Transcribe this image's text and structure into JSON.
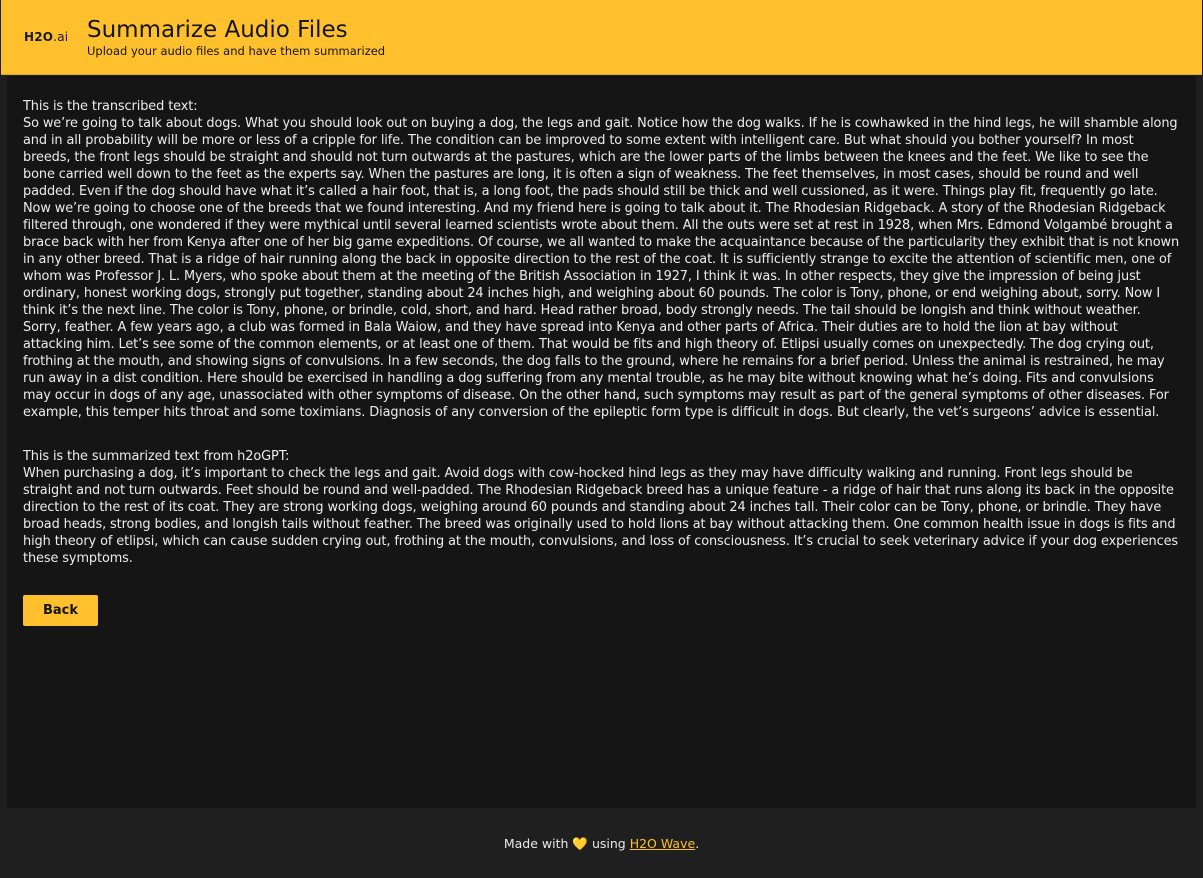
{
  "header": {
    "logo_text": "H2O",
    "logo_suffix": ".ai",
    "title": "Summarize Audio Files",
    "subtitle": "Upload your audio files and have them summarized"
  },
  "transcript": {
    "label": "This is the transcribed text:",
    "text": "So we’re going to talk about dogs. What you should look out on buying a dog, the legs and gait. Notice how the dog walks. If he is cowhawked in the hind legs, he will shamble along and in all probability will be more or less of a cripple for life. The condition can be improved to some extent with intelligent care. But what should you bother yourself? In most breeds, the front legs should be straight and should not turn outwards at the pastures, which are the lower parts of the limbs between the knees and the feet. We like to see the bone carried well down to the feet as the experts say. When the pastures are long, it is often a sign of weakness. The feet themselves, in most cases, should be round and well padded. Even if the dog should have what it’s called a hair foot, that is, a long foot, the pads should still be thick and well cussioned, as it were. Things play fit, frequently go late. Now we’re going to choose one of the breeds that we found interesting. And my friend here is going to talk about it. The Rhodesian Ridgeback. A story of the Rhodesian Ridgeback filtered through, one wondered if they were mythical until several learned scientists wrote about them. All the outs were set at rest in 1928, when Mrs. Edmond Volgambé brought a brace back with her from Kenya after one of her big game expeditions. Of course, we all wanted to make the acquaintance because of the particularity they exhibit that is not known in any other breed. That is a ridge of hair running along the back in opposite direction to the rest of the coat. It is sufficiently strange to excite the attention of scientific men, one of whom was Professor J. L. Myers, who spoke about them at the meeting of the British Association in 1927, I think it was. In other respects, they give the impression of being just ordinary, honest working dogs, strongly put together, standing about 24 inches high, and weighing about 60 pounds. The color is Tony, phone, or end weighing about, sorry. Now I think it’s the next line. The color is Tony, phone, or brindle, cold, short, and hard. Head rather broad, body strongly needs. The tail should be longish and think without weather. Sorry, feather. A few years ago, a club was formed in Bala Waiow, and they have spread into Kenya and other parts of Africa. Their duties are to hold the lion at bay without attacking him. Let’s see some of the common elements, or at least one of them. That would be fits and high theory of. Etlipsi usually comes on unexpectedly. The dog crying out, frothing at the mouth, and showing signs of convulsions. In a few seconds, the dog falls to the ground, where he remains for a brief period. Unless the animal is restrained, he may run away in a dist condition. Here should be exercised in handling a dog suffering from any mental trouble, as he may bite without knowing what he’s doing. Fits and convulsions may occur in dogs of any age, unassociated with other symptoms of disease. On the other hand, such symptoms may result as part of the general symptoms of other diseases. For example, this temper hits throat and some toximians. Diagnosis of any conversion of the epileptic form type is difficult in dogs. But clearly, the vet’s surgeons’ advice is essential."
  },
  "summary": {
    "label": "This is the summarized text from h2oGPT:",
    "text": "When purchasing a dog, it’s important to check the legs and gait. Avoid dogs with cow-hocked hind legs as they may have difficulty walking and running. Front legs should be straight and not turn outwards. Feet should be round and well-padded. The Rhodesian Ridgeback breed has a unique feature - a ridge of hair that runs along its back in the opposite direction to the rest of its coat. They are strong working dogs, weighing around 60 pounds and standing about 24 inches tall. Their color can be Tony, phone, or brindle. They have broad heads, strong bodies, and longish tails without feather. The breed was originally used to hold lions at bay without attacking them. One common health issue in dogs is fits and high theory of etlipsi, which can cause sudden crying out, frothing at the mouth, convulsions, and loss of consciousness. It’s crucial to seek veterinary advice if your dog experiences these symptoms."
  },
  "back_button": {
    "label": "Back"
  },
  "footer": {
    "prefix": "Made with",
    "heart": "💛",
    "middle": "using",
    "link_text": "H2O Wave",
    "suffix": "."
  },
  "colors": {
    "accent": "#fec02c",
    "page_bg": "#1f1f1f",
    "card_bg": "#151515",
    "text": "#ececec"
  }
}
